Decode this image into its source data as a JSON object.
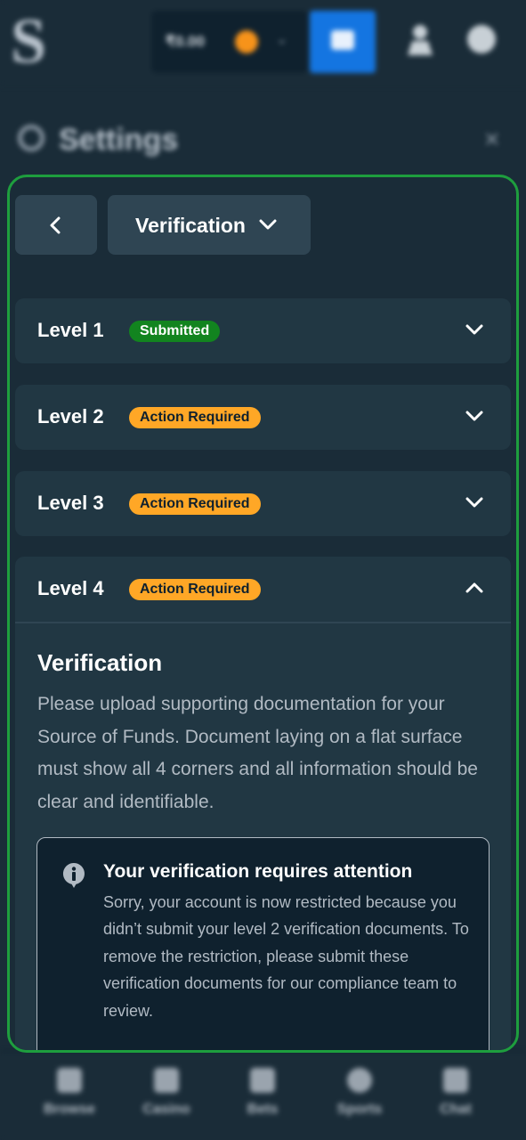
{
  "app": {
    "wallet_amount": "₹0.00",
    "settings_title": "Settings",
    "settings_close": "×"
  },
  "bottom_nav": {
    "items": [
      {
        "label": "Browse",
        "icon": "browse-icon"
      },
      {
        "label": "Casino",
        "icon": "casino-icon"
      },
      {
        "label": "Bets",
        "icon": "bets-icon"
      },
      {
        "label": "Sports",
        "icon": "sports-icon"
      },
      {
        "label": "Chat",
        "icon": "chat-icon"
      }
    ]
  },
  "toolbar": {
    "back_icon": "chevron-left-icon",
    "dropdown_label": "Verification",
    "dropdown_icon": "chevron-down-icon"
  },
  "levels": [
    {
      "label": "Level 1",
      "status": "Submitted",
      "status_color": "#12841f",
      "expanded": false
    },
    {
      "label": "Level 2",
      "status": "Action Required",
      "status_color": "#ffa726",
      "expanded": false
    },
    {
      "label": "Level 3",
      "status": "Action Required",
      "status_color": "#ffa726",
      "expanded": false
    },
    {
      "label": "Level 4",
      "status": "Action Required",
      "status_color": "#ffa726",
      "expanded": true
    }
  ],
  "level4_content": {
    "title": "Verification",
    "description": "Please upload supporting documentation for your Source of Funds. Document laying on a flat surface must show all 4 corners and all information should be clear and identifiable.",
    "alert": {
      "icon": "info-icon",
      "title": "Your verification requires attention",
      "body": "Sorry, your account is now restricted because you didn’t submit your level 2 verification documents. To remove the restriction, please submit these verification documents for our compliance team to review."
    }
  },
  "colors": {
    "highlight_border": "#1e9e3e",
    "panel": "#213743",
    "button": "#2f4553",
    "background": "#1a2c38"
  }
}
